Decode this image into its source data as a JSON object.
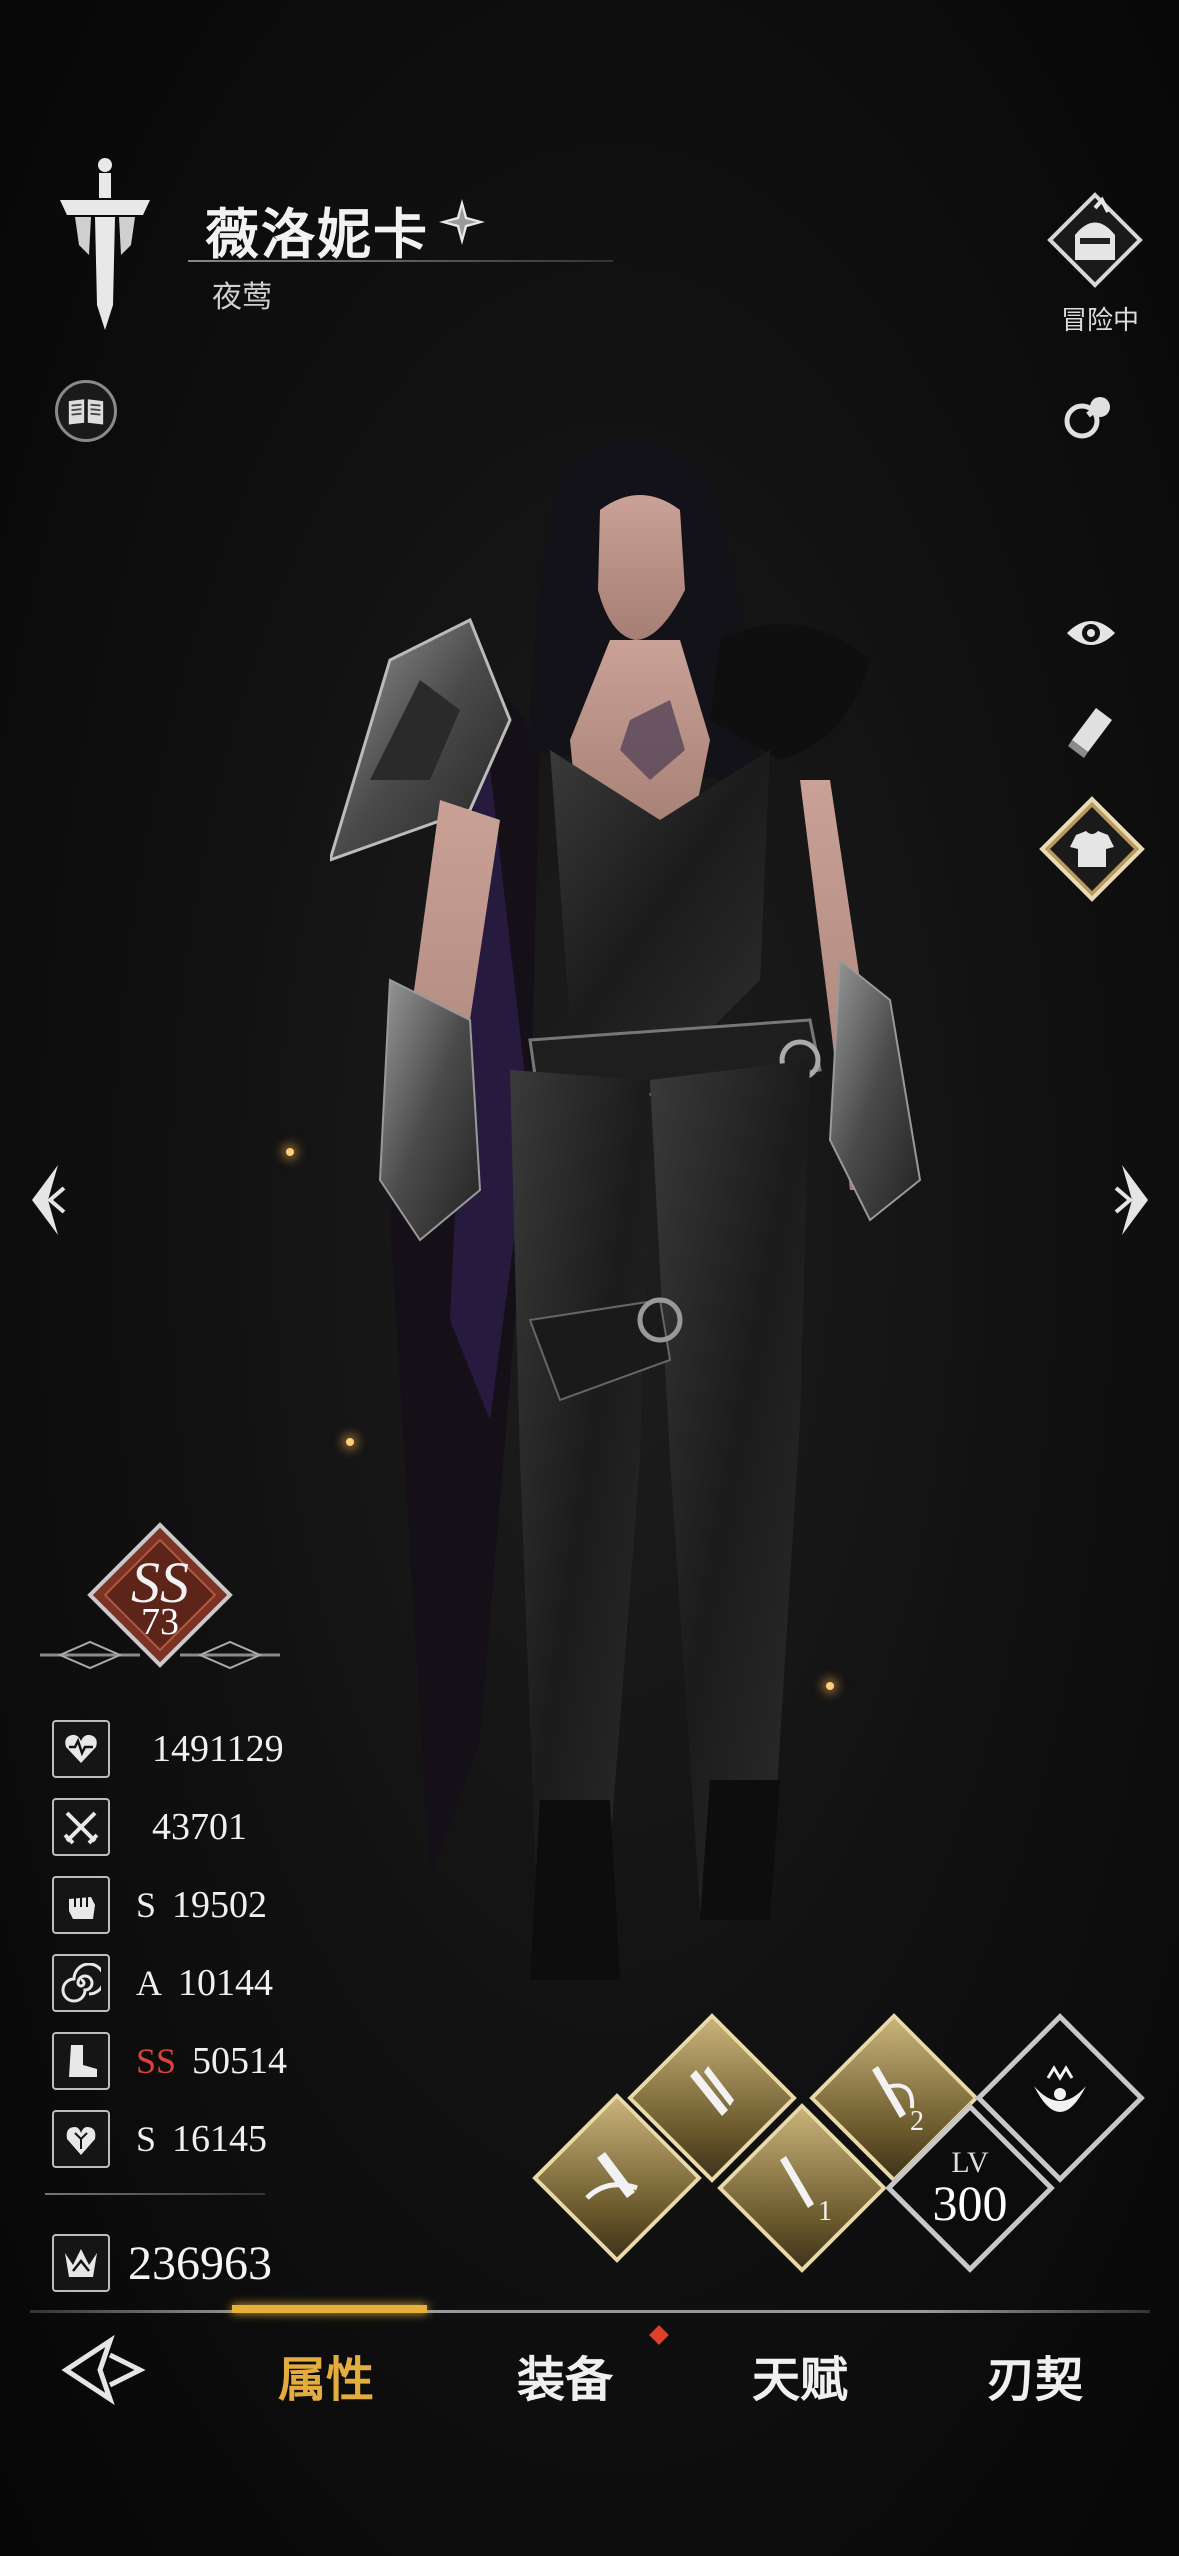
{
  "header": {
    "name": "薇洛妮卡",
    "title": "夜莺",
    "status": "冒险中"
  },
  "rank": {
    "grade": "SS",
    "level": "73"
  },
  "stats": [
    {
      "icon": "heart-icon",
      "grade": "",
      "value": "1491129",
      "grade_color": "#efefef"
    },
    {
      "icon": "crossed-swords-icon",
      "grade": "",
      "value": "43701",
      "grade_color": "#efefef"
    },
    {
      "icon": "fist-icon",
      "grade": "S",
      "value": "19502",
      "grade_color": "#efefef"
    },
    {
      "icon": "swirl-icon",
      "grade": "A",
      "value": "10144",
      "grade_color": "#efefef"
    },
    {
      "icon": "boot-icon",
      "grade": "SS",
      "value": "50514",
      "grade_color": "#e0403a"
    },
    {
      "icon": "armored-heart-icon",
      "grade": "S",
      "value": "16145",
      "grade_color": "#efefef"
    }
  ],
  "power": {
    "icon": "crown-emblem-icon",
    "value": "236963"
  },
  "skills": {
    "slot_labels": [
      "1",
      "2"
    ],
    "lv_label": "LV",
    "level": "300"
  },
  "nav": {
    "tabs": [
      "属性",
      "装备",
      "天赋",
      "刃契"
    ],
    "active": "属性"
  },
  "colors": {
    "accent_gold": "#e6b13a",
    "notice_red": "#e0402a",
    "grade_red": "#e0403a"
  }
}
